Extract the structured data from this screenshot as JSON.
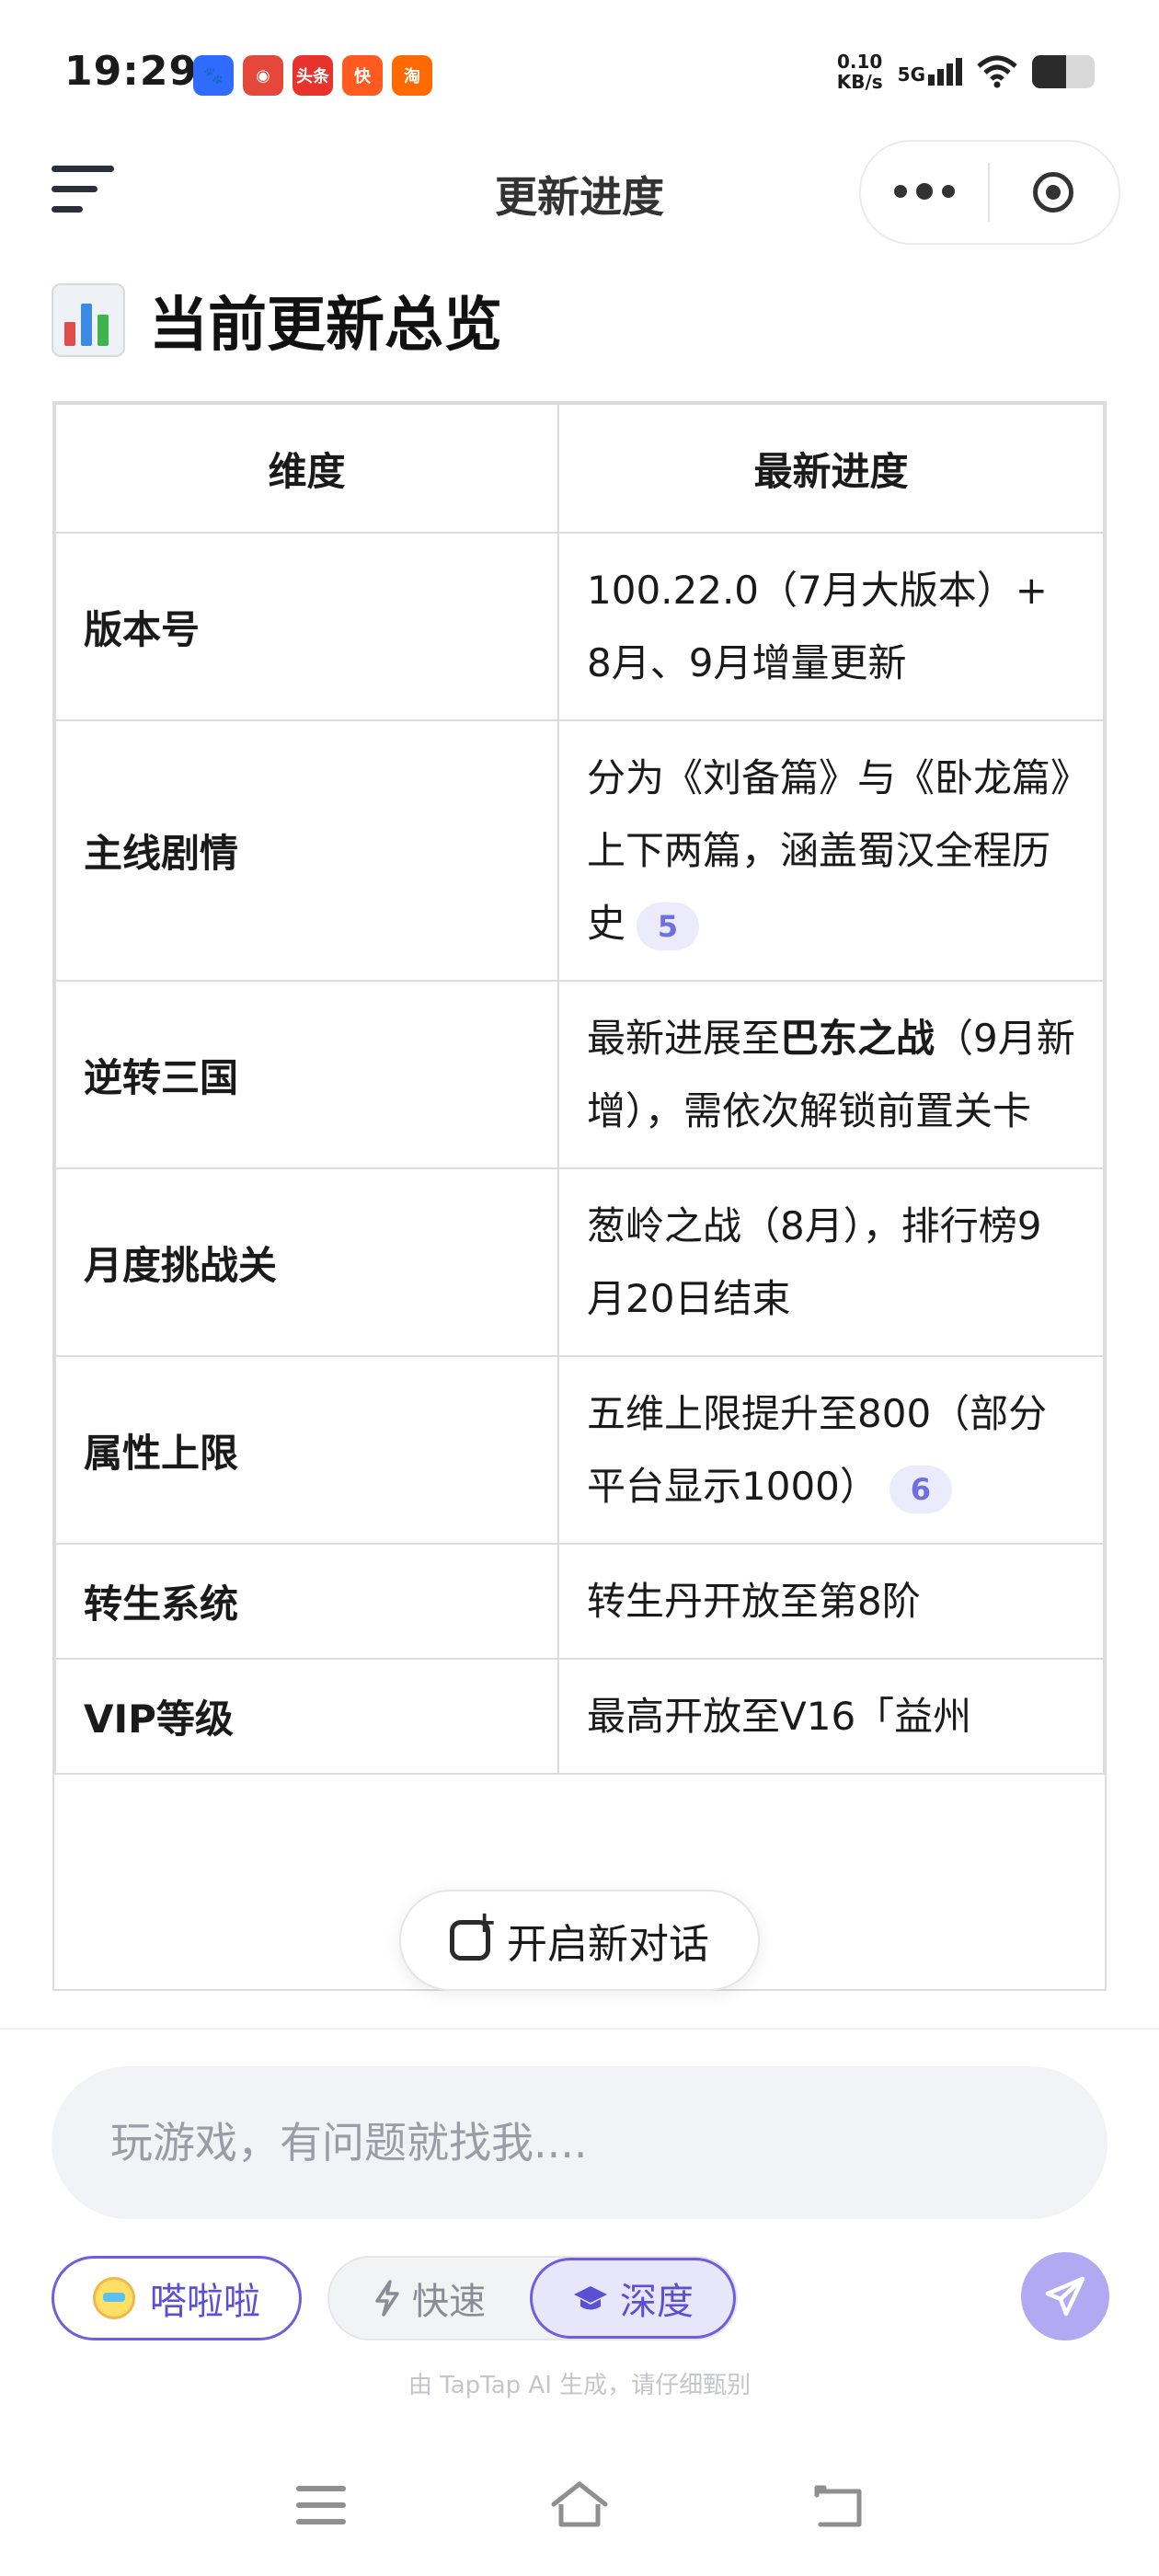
{
  "status_bar": {
    "time": "19:29",
    "net_speed_value": "0.10",
    "net_speed_unit": "KB/s",
    "network_type": "5G",
    "battery_level_percent": 55,
    "notification_apps": [
      {
        "name": "baidu-icon",
        "color": "#2f6bff",
        "text": "🐾"
      },
      {
        "name": "game-app-icon",
        "color": "#e5483a",
        "text": "◉"
      },
      {
        "name": "toutiao-icon",
        "color": "#e8322c",
        "text": "头条"
      },
      {
        "name": "kuaishou-icon",
        "color": "#ff5a1f",
        "text": "快"
      },
      {
        "name": "taobao-icon",
        "color": "#ff6a00",
        "text": "淘"
      }
    ]
  },
  "header": {
    "title": "更新进度"
  },
  "section": {
    "title": "当前更新总览",
    "icon": "bar-chart-icon"
  },
  "table": {
    "headers": [
      "维度",
      "最新进度"
    ],
    "rows": [
      {
        "dimension": "版本号",
        "progress": "100.22.0（7月大版本）+ 8月、9月增量更新"
      },
      {
        "dimension": "主线剧情",
        "progress": "分为《刘备篇》与《卧龙篇》上下两篇，涵盖蜀汉全程历史",
        "citation": "5"
      },
      {
        "dimension": "逆转三国",
        "progress_prefix": "最新进展至",
        "progress_bold": "巴东之战",
        "progress_suffix": "（9月新增），需依次解锁前置关卡"
      },
      {
        "dimension": "月度挑战关",
        "progress": "葱岭之战（8月），排行榜9月20日结束"
      },
      {
        "dimension": "属性上限",
        "progress": "五维上限提升至800（部分平台显示1000）",
        "citation": "6"
      },
      {
        "dimension": "转生系统",
        "progress": "转生丹开放至第8阶"
      },
      {
        "dimension": "VIP等级",
        "progress": "最高开放至V16「益州"
      }
    ]
  },
  "new_chat": {
    "label": "开启新对话"
  },
  "composer": {
    "placeholder": "玩游戏，有问题就找我...."
  },
  "controls": {
    "persona_label": "嗒啦啦",
    "mode_fast_label": "快速",
    "mode_deep_label": "深度",
    "selected_mode": "深度"
  },
  "disclaimer": "由 TapTap AI 生成，请仔细甄别",
  "colors": {
    "accent": "#6d5fe0",
    "accent_light": "#b3a9f2",
    "citation_bg": "#ebebfb"
  }
}
